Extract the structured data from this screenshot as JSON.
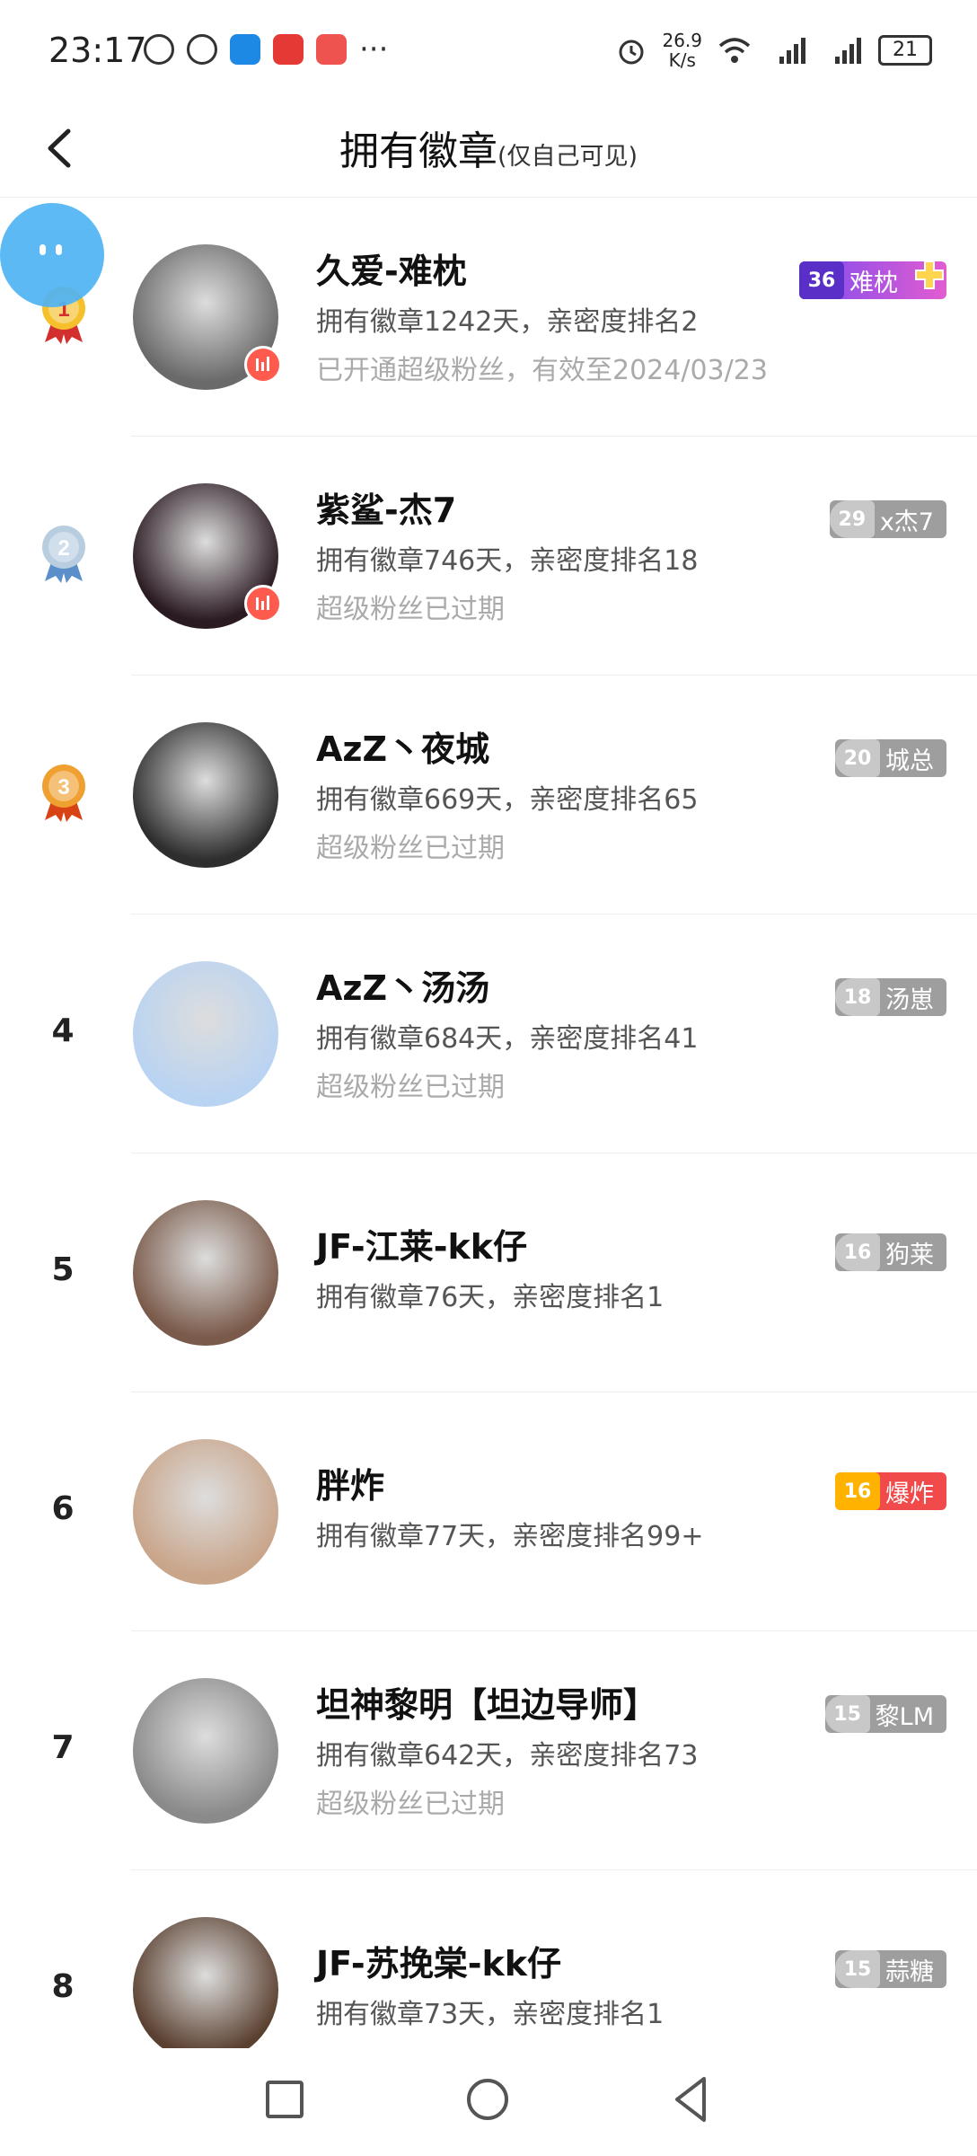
{
  "status_bar": {
    "time": "23:17",
    "net_speed_value": "26.9",
    "net_speed_unit": "K/s",
    "battery": "21",
    "icons": [
      "alarm-icon",
      "jdm-icon",
      "weather-icon",
      "huawei-icon",
      "book-icon",
      "more-dots-icon",
      "clock-icon",
      "wifi-icon",
      "signal-4g-icon",
      "signal-4g-icon",
      "battery-icon"
    ]
  },
  "header": {
    "title": "拥有徽章",
    "subtitle": "(仅自己可见)",
    "back_icon": "chevron-left-icon"
  },
  "list": [
    {
      "rank": "1",
      "medal": "gold",
      "name": "久爱-难枕",
      "line1": "拥有徽章1242天，亲密度排名2",
      "line2": "已开通超级粉丝，有效至2024/03/23",
      "badge_level": "36",
      "badge_name": "难枕",
      "badge_style": "purple",
      "live": true,
      "avatar_color": "#6a6a6a"
    },
    {
      "rank": "2",
      "medal": "silver",
      "name": "紫鲨-杰7",
      "line1": "拥有徽章746天，亲密度排名18",
      "line2": "超级粉丝已过期",
      "badge_level": "29",
      "badge_name": "x杰7",
      "badge_style": "grey",
      "live": true,
      "avatar_color": "#2a1a22"
    },
    {
      "rank": "3",
      "medal": "bronze",
      "name": "AzZ丶夜城",
      "line1": "拥有徽章669天，亲密度排名65",
      "line2": "超级粉丝已过期",
      "badge_level": "20",
      "badge_name": "城总",
      "badge_style": "grey",
      "live": false,
      "avatar_color": "#2e2e2e"
    },
    {
      "rank": "4",
      "medal": "",
      "name": "AzZ丶汤汤",
      "line1": "拥有徽章684天，亲密度排名41",
      "line2": "超级粉丝已过期",
      "badge_level": "18",
      "badge_name": "汤崽",
      "badge_style": "grey",
      "live": false,
      "avatar_color": "#b9d3f2"
    },
    {
      "rank": "5",
      "medal": "",
      "name": "JF-江莱-kk仔",
      "line1": "拥有徽章76天，亲密度排名1",
      "line2": "",
      "badge_level": "16",
      "badge_name": "狗莱",
      "badge_style": "grey",
      "live": false,
      "avatar_color": "#7a5a4a"
    },
    {
      "rank": "6",
      "medal": "",
      "name": "胖炸",
      "line1": "拥有徽章77天，亲密度排名99+",
      "line2": "",
      "badge_level": "16",
      "badge_name": "爆炸",
      "badge_style": "red",
      "live": false,
      "avatar_color": "#c9a58a"
    },
    {
      "rank": "7",
      "medal": "",
      "name": "坦神黎明【坦边导师】",
      "line1": "拥有徽章642天，亲密度排名73",
      "line2": "超级粉丝已过期",
      "badge_level": "15",
      "badge_name": "黎LM",
      "badge_style": "grey",
      "live": false,
      "avatar_color": "#8a8a8a"
    },
    {
      "rank": "8",
      "medal": "",
      "name": "JF-苏挽棠-kk仔",
      "line1": "拥有徽章73天，亲密度排名1",
      "line2": "",
      "badge_level": "15",
      "badge_name": "蒜糖",
      "badge_style": "grey",
      "live": false,
      "avatar_color": "#5a4030"
    }
  ],
  "colors": {
    "accent_live": "#ff5a4e",
    "badge_grey": "#9e9e9e",
    "badge_purple": "#a85cf0",
    "badge_red": "#f04a4a",
    "bubble": "#4fb4f4"
  }
}
